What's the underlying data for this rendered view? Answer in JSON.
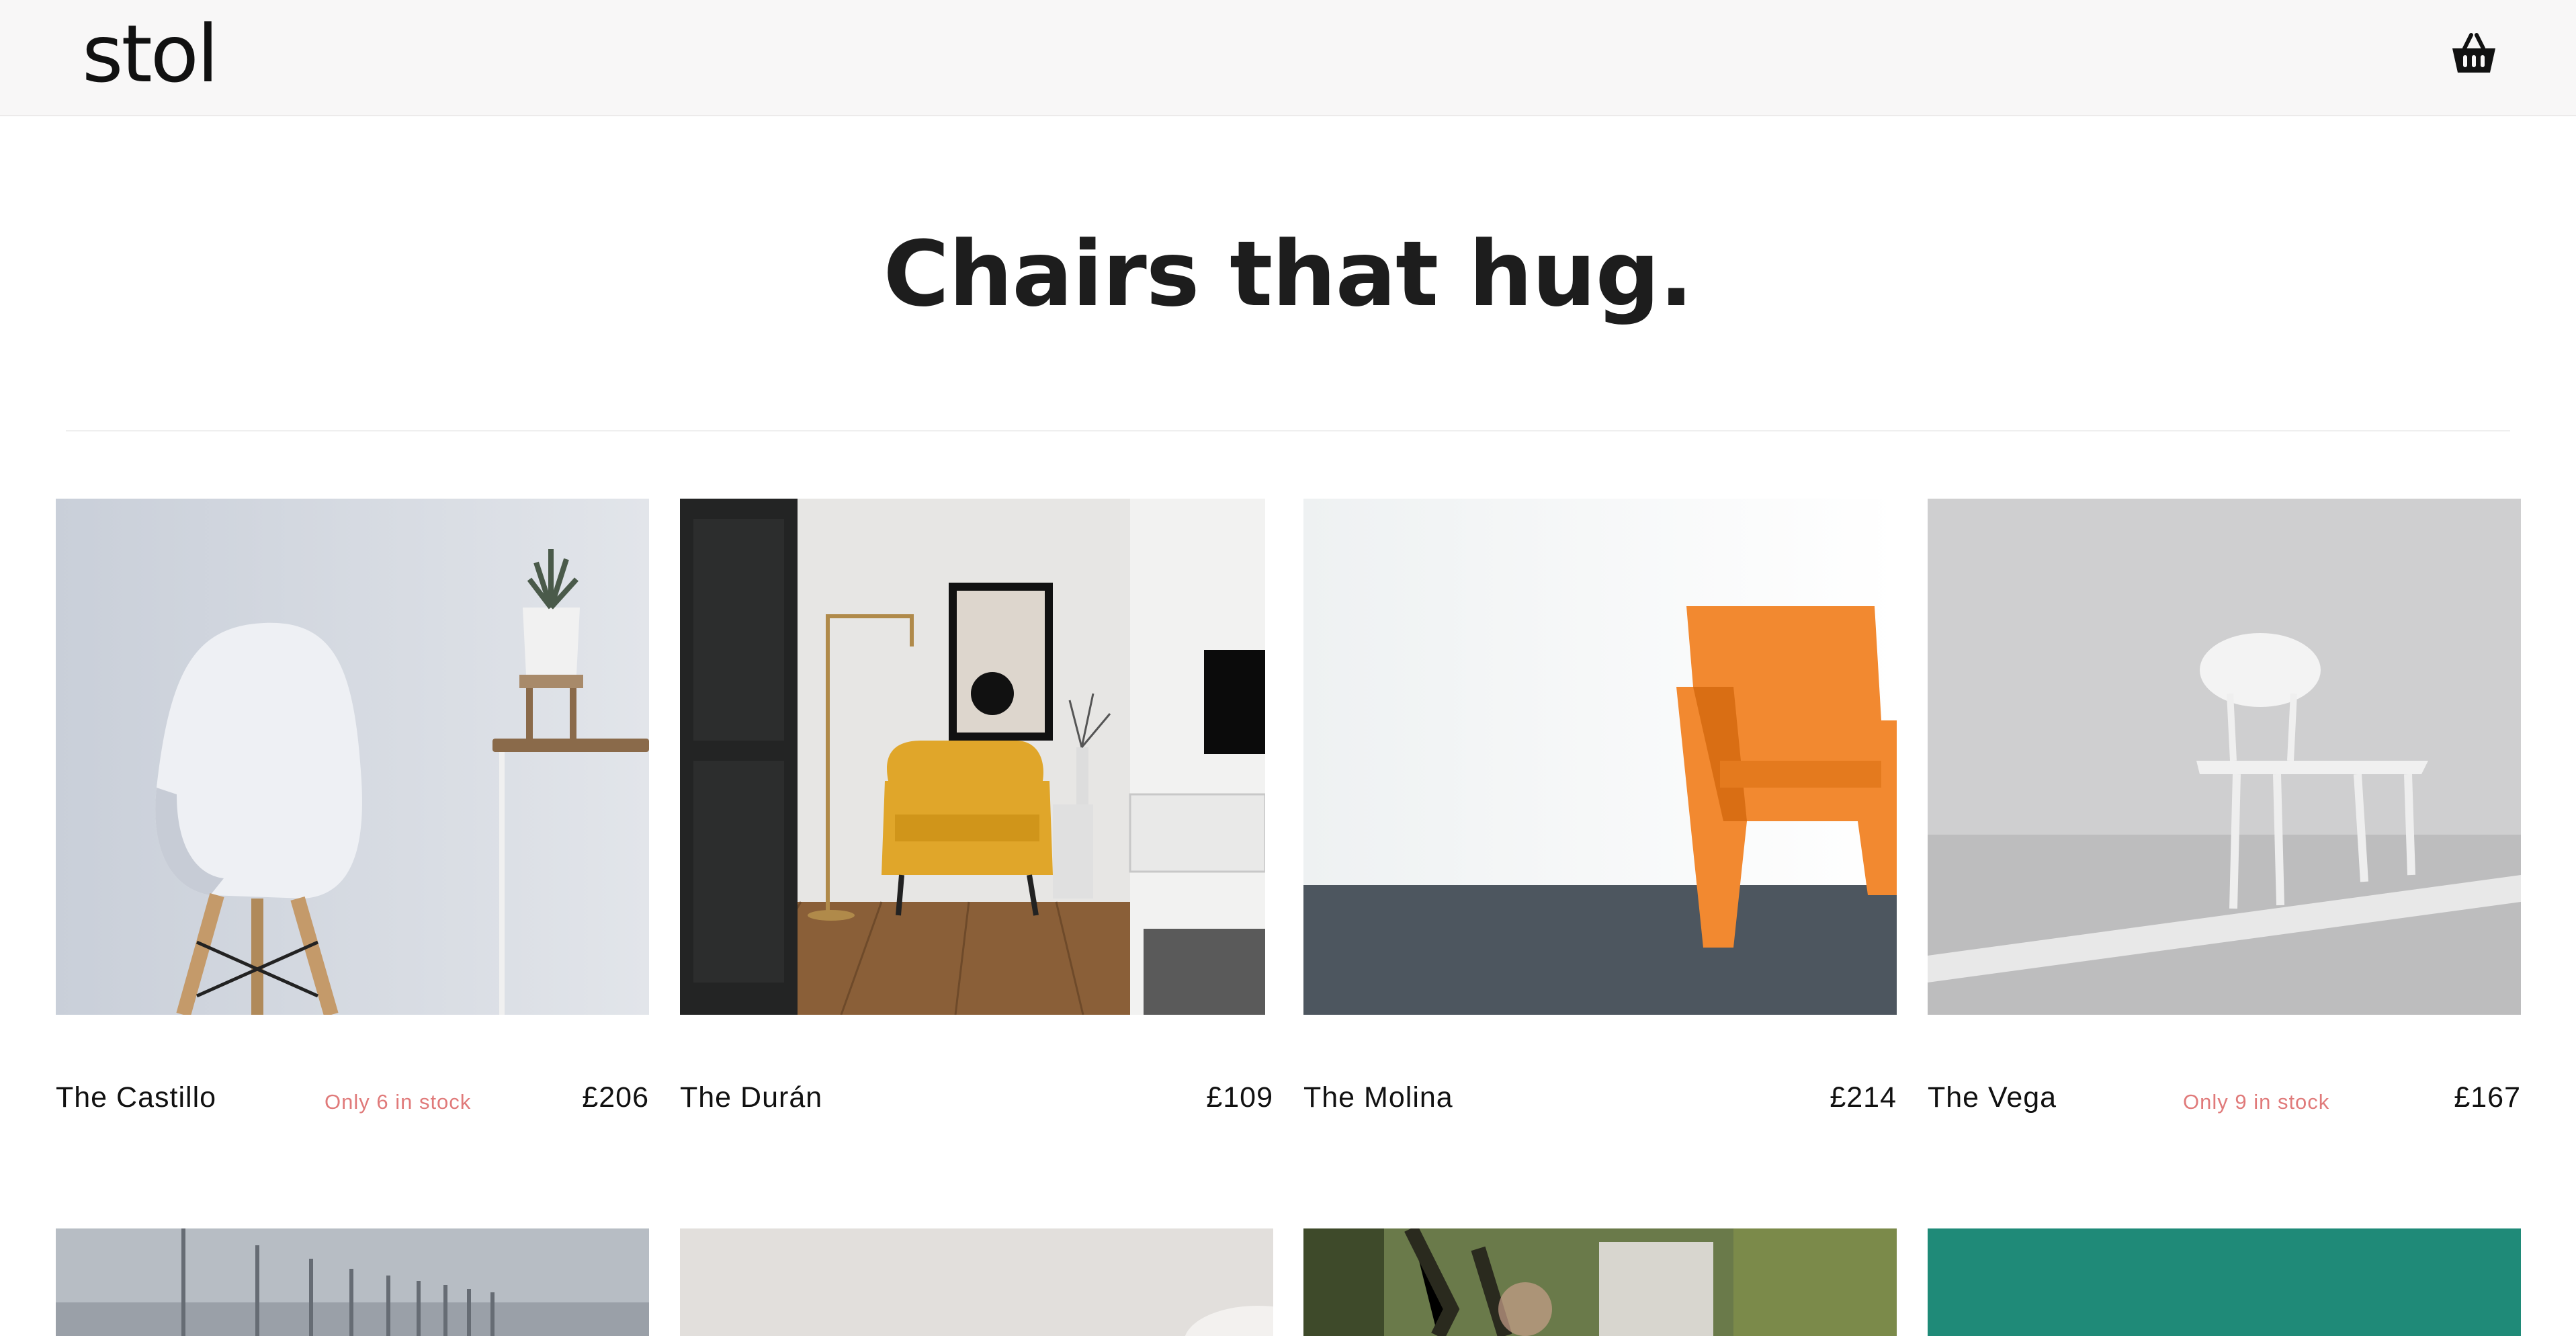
{
  "header": {
    "logo": "stol",
    "cart_icon": "basket-icon"
  },
  "hero": {
    "title": "Chairs that hug."
  },
  "products": [
    {
      "name": "The Castillo",
      "stock": "Only 6 in stock",
      "price": "£206"
    },
    {
      "name": "The Durán",
      "stock": "",
      "price": "£109"
    },
    {
      "name": "The Molina",
      "stock": "",
      "price": "£214"
    },
    {
      "name": "The Vega",
      "stock": "Only 9 in stock",
      "price": "£167"
    }
  ],
  "colors": {
    "header_bg": "#f8f7f7",
    "stock_warning": "#e07a7a",
    "text": "#111111"
  }
}
